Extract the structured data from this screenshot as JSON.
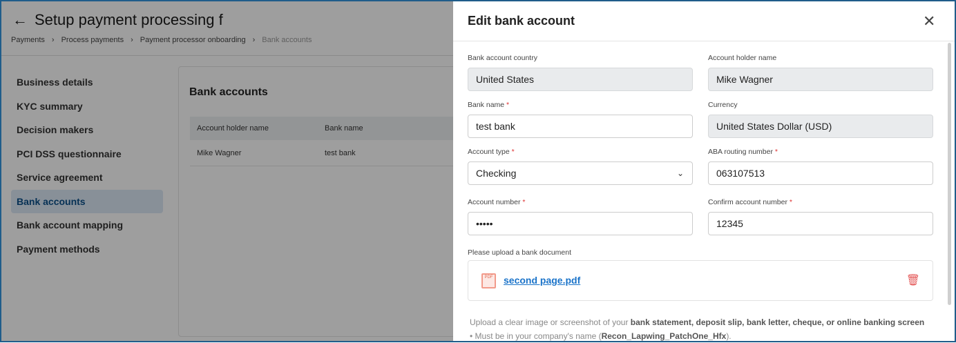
{
  "page": {
    "title": "Setup payment processing f",
    "breadcrumbs": [
      "Payments",
      "Process payments",
      "Payment processor onboarding",
      "Bank accounts"
    ]
  },
  "sidebar": {
    "items": [
      {
        "label": "Business details"
      },
      {
        "label": "KYC summary"
      },
      {
        "label": "Decision makers"
      },
      {
        "label": "PCI DSS questionnaire"
      },
      {
        "label": "Service agreement"
      },
      {
        "label": "Bank accounts",
        "active": true
      },
      {
        "label": "Bank account mapping"
      },
      {
        "label": "Payment methods"
      }
    ]
  },
  "main": {
    "title": "Bank accounts",
    "columns": [
      "Account holder name",
      "Bank name"
    ],
    "rows": [
      [
        "Mike Wagner",
        "test bank"
      ]
    ]
  },
  "drawer": {
    "title": "Edit bank account",
    "fields": {
      "country": {
        "label": "Bank account country",
        "value": "United States"
      },
      "holder": {
        "label": "Account holder name",
        "value": "Mike Wagner"
      },
      "bank": {
        "label": "Bank name",
        "value": "test bank"
      },
      "currency": {
        "label": "Currency",
        "value": "United States Dollar (USD)"
      },
      "type": {
        "label": "Account type",
        "value": "Checking"
      },
      "routing": {
        "label": "ABA routing number",
        "value": "063107513"
      },
      "account": {
        "label": "Account number",
        "value": "•••••"
      },
      "confirm": {
        "label": "Confirm account number",
        "value": "12345"
      }
    },
    "required_mark": "*",
    "upload": {
      "label": "Please upload a bank document",
      "file_name": "second page.pdf",
      "file_badge": "PDF"
    },
    "help": {
      "intro": "Upload a clear image or screenshot of your ",
      "intro_bold": "bank statement, deposit slip, bank letter, cheque, or online banking screen",
      "bullet": "Must be in your company's name (",
      "bullet_bold": "Recon_Lapwing_PatchOne_Hfx",
      "bullet_end": ")."
    }
  },
  "colors": {
    "accent": "#1a73c9",
    "danger": "#e45757",
    "active_nav": "#0b4f8a"
  }
}
